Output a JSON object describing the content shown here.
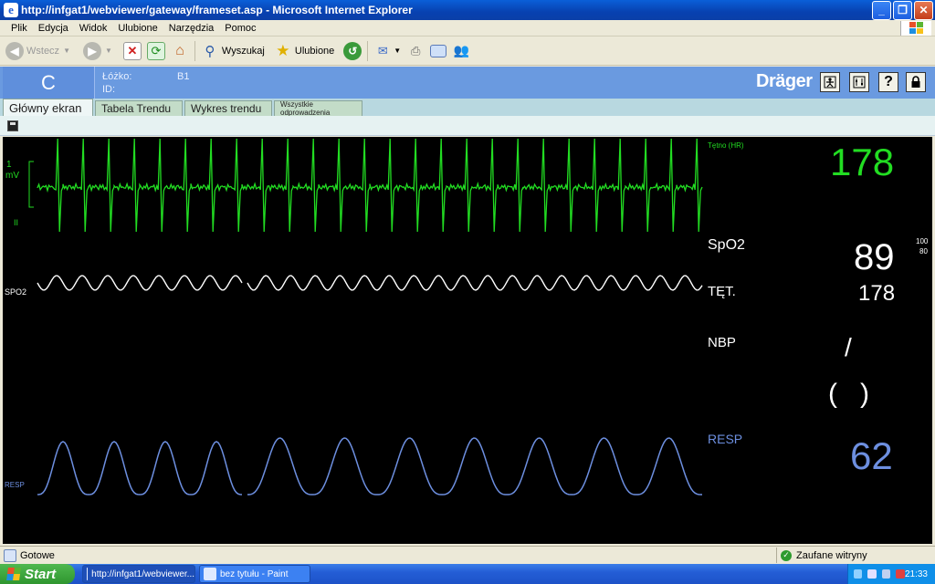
{
  "window": {
    "title": "http://infgat1/webviewer/gateway/frameset.asp - Microsoft Internet Explorer"
  },
  "menu": [
    "Plik",
    "Edycja",
    "Widok",
    "Ulubione",
    "Narzędzia",
    "Pomoc"
  ],
  "toolbar": {
    "back": "Wstecz",
    "search": "Wyszukaj",
    "favorites": "Ulubione"
  },
  "header": {
    "bed_letter": "C",
    "bed_label": "Łóżko:",
    "bed_value": "B1",
    "id_label": "ID:",
    "brand": "Dräger"
  },
  "tabs": [
    {
      "label": "Główny ekran",
      "active": true
    },
    {
      "label": "Tabela Trendu"
    },
    {
      "label": "Wykres trendu"
    },
    {
      "label": "Wszystkie odprowadzenia"
    }
  ],
  "monitor": {
    "ecg": {
      "scale_num": "1",
      "scale_unit": "mV",
      "lead": "II",
      "param_label": "Tętno (HR)",
      "value": "178",
      "color": "#22dd22",
      "beats": 26
    },
    "spo2": {
      "wave_label": "SPO2",
      "param_label": "SpO2",
      "value": "89",
      "alarm_high": "100",
      "alarm_low": "80",
      "pulse_label": "TĘT.",
      "pulse_value": "178",
      "color": "#ffffff"
    },
    "nbp": {
      "param_label": "NBP",
      "slash": "/",
      "mean": "(   )",
      "color": "#ffffff"
    },
    "resp": {
      "wave_label": "RESP",
      "param_label": "RESP",
      "value": "62",
      "color": "#6d8fe0",
      "breaths": 10
    }
  },
  "status": {
    "text": "Gotowe",
    "zone": "Zaufane witryny"
  },
  "taskbar": {
    "start": "Start",
    "tasks": [
      {
        "label": "http://infgat1/webviewer..."
      },
      {
        "label": "bez tytułu - Paint"
      }
    ],
    "clock": "21:33"
  }
}
